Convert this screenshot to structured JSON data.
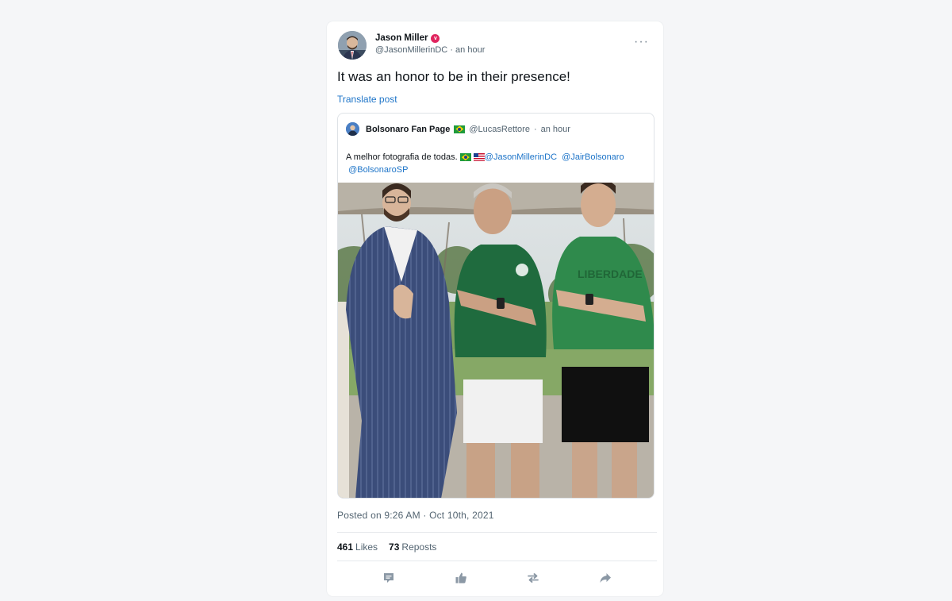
{
  "post": {
    "author_name": "Jason Miller",
    "verified_badge": "v",
    "handle": "@JasonMillerinDC",
    "separator": "·",
    "time": "an hour",
    "more_label": "···",
    "text": "It was an honor to be in their presence!",
    "translate_label": "Translate post",
    "posted": "Posted on 9:26 AM · Oct 10th, 2021",
    "likes_count": "461",
    "likes_label": "Likes",
    "reposts_count": "73",
    "reposts_label": "Reposts"
  },
  "quote": {
    "author_name": "Bolsonaro Fan Page",
    "flag": "brazil-flag-icon",
    "handle": "@LucasRettore",
    "separator": "·",
    "time": "an hour",
    "text_prefix": "A melhor fotografia de todas.",
    "mentions": [
      "@JasonMillerinDC",
      "@JairBolsonaro",
      "@BolsonaroSP"
    ],
    "image_alt": "Three men posing outdoors"
  },
  "actions": [
    "comment-icon",
    "like-icon",
    "repost-icon",
    "share-icon"
  ],
  "colors": {
    "background": "#f5f6f8",
    "card": "#ffffff",
    "link": "#1d74c8",
    "muted": "#536471",
    "verified": "#e0245e",
    "action_icon": "#8b98a5"
  }
}
